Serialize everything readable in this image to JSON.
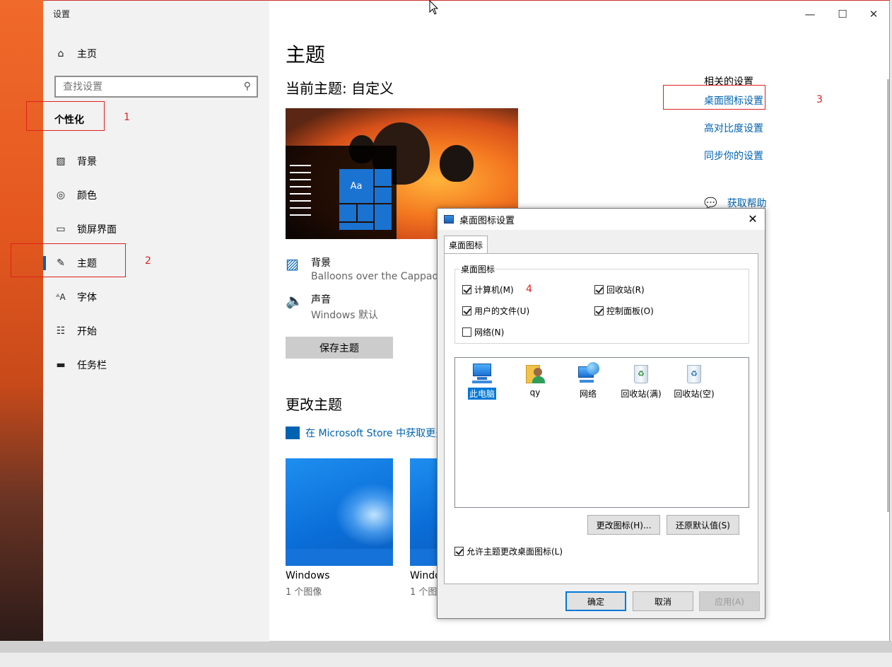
{
  "window": {
    "title": "设置",
    "minimize": "—",
    "maximize": "☐",
    "close": "✕"
  },
  "sidebar": {
    "home": "主页",
    "search_placeholder": "查找设置",
    "section": "个性化",
    "items": [
      {
        "label": "背景",
        "icon": "image-icon"
      },
      {
        "label": "颜色",
        "icon": "palette-icon"
      },
      {
        "label": "锁屏界面",
        "icon": "lockscreen-icon"
      },
      {
        "label": "主题",
        "icon": "theme-brush-icon"
      },
      {
        "label": "字体",
        "icon": "font-icon"
      },
      {
        "label": "开始",
        "icon": "start-icon"
      },
      {
        "label": "任务栏",
        "icon": "taskbar-icon"
      }
    ]
  },
  "main": {
    "title": "主题",
    "current_theme": "当前主题: 自定义",
    "background_label": "背景",
    "background_value": "Balloons over the Cappadoci",
    "sound_label": "声音",
    "sound_value": "Windows 默认",
    "save_button": "保存主题",
    "change_theme": "更改主题",
    "store_link": "在 Microsoft Store 中获取更多",
    "themes": [
      {
        "name": "Windows",
        "count": "1 个图像"
      },
      {
        "name": "Windo",
        "count": "1 个图"
      }
    ],
    "preview_tile_text": "Aa"
  },
  "related": {
    "heading": "相关的设置",
    "links": [
      "桌面图标设置",
      "高对比度设置",
      "同步你的设置"
    ],
    "help": "获取帮助"
  },
  "annotations": [
    "1",
    "2",
    "3",
    "4"
  ],
  "dialog": {
    "title": "桌面图标设置",
    "tab": "桌面图标",
    "group_label": "桌面图标",
    "checkboxes": [
      {
        "label": "计算机(M)",
        "checked": true
      },
      {
        "label": "回收站(R)",
        "checked": true
      },
      {
        "label": "用户的文件(U)",
        "checked": true
      },
      {
        "label": "控制面板(O)",
        "checked": true
      },
      {
        "label": "网络(N)",
        "checked": false
      }
    ],
    "icons": [
      {
        "label": "此电脑",
        "icon": "computer-icon",
        "selected": true
      },
      {
        "label": "qy",
        "icon": "user-folder-icon",
        "selected": false
      },
      {
        "label": "网络",
        "icon": "network-icon",
        "selected": false
      },
      {
        "label": "回收站(满)",
        "icon": "recycle-bin-full-icon",
        "selected": false
      },
      {
        "label": "回收站(空)",
        "icon": "recycle-bin-empty-icon",
        "selected": false
      }
    ],
    "change_icon_button": "更改图标(H)...",
    "restore_default_button": "还原默认值(S)",
    "allow_themes": "允许主题更改桌面图标(L)",
    "ok": "确定",
    "cancel": "取消",
    "apply": "应用(A)"
  }
}
